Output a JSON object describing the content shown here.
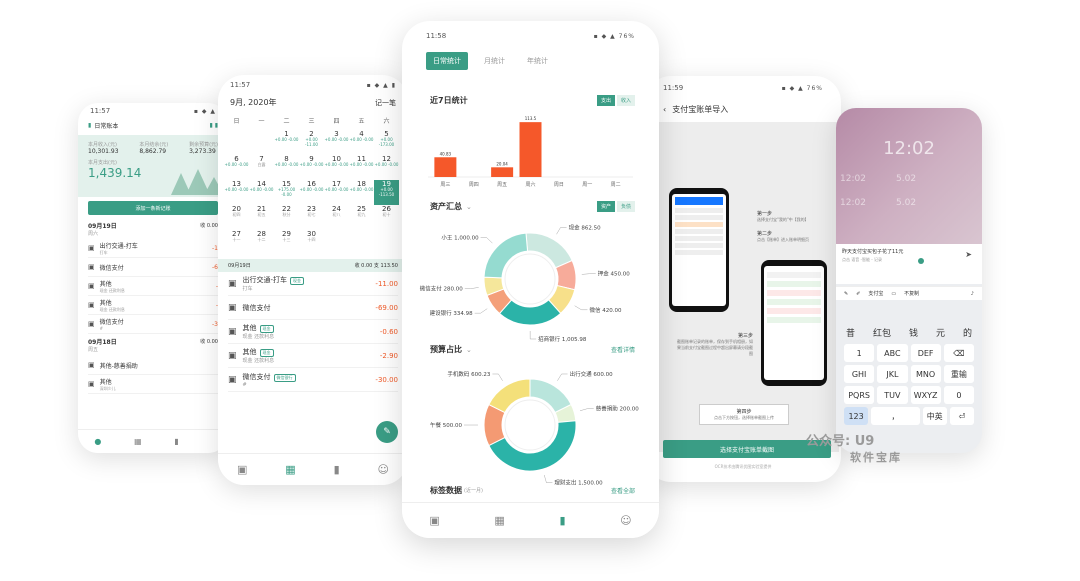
{
  "p1": {
    "time": "11:57",
    "title": "日常账本",
    "stat_labels": [
      "本月收入(元)",
      "本月结余(元)",
      "剩余预算(元)"
    ],
    "stat_values": [
      "10,301.93",
      "8,862.79",
      "3,273.39"
    ],
    "today_label": "本月支出(元)",
    "today_value": "1,439.14",
    "add_btn": "添加一条新记账",
    "day1": {
      "date": "09月19日",
      "week": "周六",
      "sum": "收 0.00"
    },
    "items1": [
      {
        "name": "出行交通-打车",
        "sub": "打车",
        "amt": "-1"
      },
      {
        "name": "微信支付",
        "sub": "",
        "amt": "-6"
      },
      {
        "name": "其他",
        "sub": "现金 还款利息",
        "amt": "-"
      },
      {
        "name": "其他",
        "sub": "现金 还款利息",
        "amt": "-"
      },
      {
        "name": "微信支付",
        "sub": "#",
        "amt": "-3"
      }
    ],
    "day2": {
      "date": "09月18日",
      "week": "周五",
      "sum": "收 0.00"
    },
    "items2": [
      {
        "name": "其他-慈善捐助",
        "sub": "",
        "amt": ""
      },
      {
        "name": "其他",
        "sub": "深圳少儿",
        "amt": ""
      }
    ]
  },
  "p2": {
    "time": "11:57",
    "month": "9月, 2020年",
    "action": "记一笔",
    "weekdays": [
      "日",
      "一",
      "二",
      "三",
      "四",
      "五",
      "六"
    ],
    "weeks": [
      [
        {
          "d": "",
          "t": ""
        },
        {
          "d": "",
          "t": ""
        },
        {
          "d": "1",
          "t": "+0.00 -0.00"
        },
        {
          "d": "2",
          "t": "+0.00 -11.00"
        },
        {
          "d": "3",
          "t": "+0.00 -0.00"
        },
        {
          "d": "4",
          "t": "+0.00 -0.00"
        },
        {
          "d": "5",
          "t": "+0.00 -173.00"
        }
      ],
      [
        {
          "d": "6",
          "t": "+0.00 -0.00"
        },
        {
          "d": "7",
          "t": "白露"
        },
        {
          "d": "8",
          "t": "+0.00 -0.00"
        },
        {
          "d": "9",
          "t": "+0.00 -0.00"
        },
        {
          "d": "10",
          "t": "+0.00 -0.00"
        },
        {
          "d": "11",
          "t": "+0.00 -0.00"
        },
        {
          "d": "12",
          "t": "+0.00 -0.00"
        }
      ],
      [
        {
          "d": "13",
          "t": "+0.00 -0.00"
        },
        {
          "d": "14",
          "t": "+0.00 -0.00"
        },
        {
          "d": "15",
          "t": "+175.00 -0.00"
        },
        {
          "d": "16",
          "t": "+0.00 -0.00"
        },
        {
          "d": "17",
          "t": "+0.00 -0.00"
        },
        {
          "d": "18",
          "t": "+0.00 -0.00"
        },
        {
          "d": "19",
          "t": "+0.00 -113.50"
        }
      ],
      [
        {
          "d": "20",
          "t": "初四"
        },
        {
          "d": "21",
          "t": "初五"
        },
        {
          "d": "22",
          "t": "秋分"
        },
        {
          "d": "23",
          "t": "初七"
        },
        {
          "d": "24",
          "t": "初八"
        },
        {
          "d": "25",
          "t": "初九"
        },
        {
          "d": "26",
          "t": "初十"
        }
      ],
      [
        {
          "d": "27",
          "t": "十一"
        },
        {
          "d": "28",
          "t": "十二"
        },
        {
          "d": "29",
          "t": "十三"
        },
        {
          "d": "30",
          "t": "十四"
        },
        {
          "d": "",
          "t": ""
        },
        {
          "d": "",
          "t": ""
        },
        {
          "d": "",
          "t": ""
        }
      ]
    ],
    "selected_label": "09月19日",
    "selected_sum": "收 0.00  支 113.50",
    "items": [
      {
        "name": "出行交通-打车",
        "sub": "打车",
        "tag": "现金",
        "amt": "-11.00"
      },
      {
        "name": "微信支付",
        "sub": "",
        "tag": "",
        "amt": "-69.00"
      },
      {
        "name": "其他",
        "sub": "现金 还款利息",
        "tag": "现金",
        "amt": "-0.60"
      },
      {
        "name": "其他",
        "sub": "现金 还款利息",
        "tag": "现金",
        "amt": "-2.90"
      },
      {
        "name": "微信支付",
        "sub": "#",
        "tag": "微信银行",
        "amt": "-30.00"
      }
    ]
  },
  "p3": {
    "time": "11:58",
    "battery": "76%",
    "tabs": [
      "日常统计",
      "月统计",
      "年统计"
    ],
    "s1_title": "近7日统计",
    "toggle1": [
      "支出",
      "收入"
    ],
    "s2_title": "资产汇总",
    "toggle2": [
      "资产",
      "负债"
    ],
    "s3_title": "预算占比",
    "s3_link": "查看详情",
    "s4_title": "标签数据",
    "s4_sub": "(近一月)",
    "s4_link": "查看全部"
  },
  "chart_data": [
    {
      "type": "bar",
      "title": "近7日统计",
      "categories": [
        "周三",
        "周四",
        "周五",
        "周六",
        "周日",
        "周一",
        "周二"
      ],
      "values": [
        40.83,
        0,
        20.04,
        113.5,
        0,
        0,
        0
      ],
      "value_labels": [
        "40.83",
        "",
        "20.04",
        "113.5",
        "",
        "",
        ""
      ],
      "ylim": [
        0,
        120
      ],
      "color": "#f5582a"
    },
    {
      "type": "pie",
      "title": "资产汇总",
      "labels": [
        "现金 862.50",
        "押金 450.00",
        "微信 420.00",
        "招商银行 1,005.98",
        "建设银行 334.98",
        "微信支付 280.00",
        "小王 1,000.00"
      ],
      "values": [
        862.5,
        450.0,
        420.0,
        1005.98,
        334.98,
        280.0,
        1000.0
      ],
      "colors": [
        "#cce8e0",
        "#f7ab9a",
        "#f7e08a",
        "#2bb3a8",
        "#f4a07a",
        "#f5e79b",
        "#95dbd0"
      ]
    },
    {
      "type": "pie",
      "title": "预算占比",
      "labels": [
        "出行交通 600.00",
        "慈善捐助 200.00",
        "理财支出 1,500.00",
        "午餐 500.00",
        "手机数码 600.23"
      ],
      "values": [
        600.0,
        200.0,
        1500.0,
        500.0,
        600.23
      ],
      "colors": [
        "#b9e5dc",
        "#e6f3d8",
        "#2bb3a8",
        "#f49a73",
        "#f4e07a"
      ]
    }
  ],
  "p4": {
    "time": "11:59",
    "battery": "76%",
    "title": "支付宝账单导入",
    "step1": "第一步",
    "step1_desc": "选择支付宝\"我的\"中【我的】",
    "step2": "第二步",
    "step2_desc": "点击【账单】进入账单明细页",
    "step3": "第三步",
    "step3_desc": "截图账单记录的账单，保存到手机相册，如果当前支付宝截图过程中超出屏幕请分段截图",
    "step4": "第四步",
    "step4_desc": "点击下方按钮，选择账单截图上传",
    "btn": "选择支付宝账单截图",
    "footnote": "OCR技术由腾讯优图实验室提供"
  },
  "p5": {
    "clock": "12:02",
    "times": [
      "12:02",
      "5.02",
      "12:02",
      "5.02",
      "12:02",
      "12:02"
    ],
    "input_text": "昨天支付宝买包子花了11元",
    "input_sub": "点击 语音 -智能 - 记录",
    "toolbar": [
      "支付宝",
      "不复制"
    ],
    "suggestions": [
      "昔",
      "红包",
      "钱",
      "元",
      "的"
    ],
    "keys": [
      [
        {
          "k": "1",
          "s": ""
        },
        {
          "k": "ABC",
          "s": ""
        },
        {
          "k": "DEF",
          "s": ""
        },
        {
          "k": "⌫",
          "s": ""
        }
      ],
      [
        {
          "k": "GHI",
          "s": ""
        },
        {
          "k": "JKL",
          "s": ""
        },
        {
          "k": "MNO",
          "s": ""
        },
        {
          "k": "重输",
          "s": ""
        }
      ],
      [
        {
          "k": "PQRS",
          "s": ""
        },
        {
          "k": "TUV",
          "s": ""
        },
        {
          "k": "WXYZ",
          "s": ""
        },
        {
          "k": "0",
          "s": ""
        }
      ]
    ],
    "bottom_keys": [
      "123",
      "，",
      "中英",
      "⏎"
    ]
  },
  "watermark": {
    "line1": "公众号: U9",
    "line2": "软件宝库"
  }
}
